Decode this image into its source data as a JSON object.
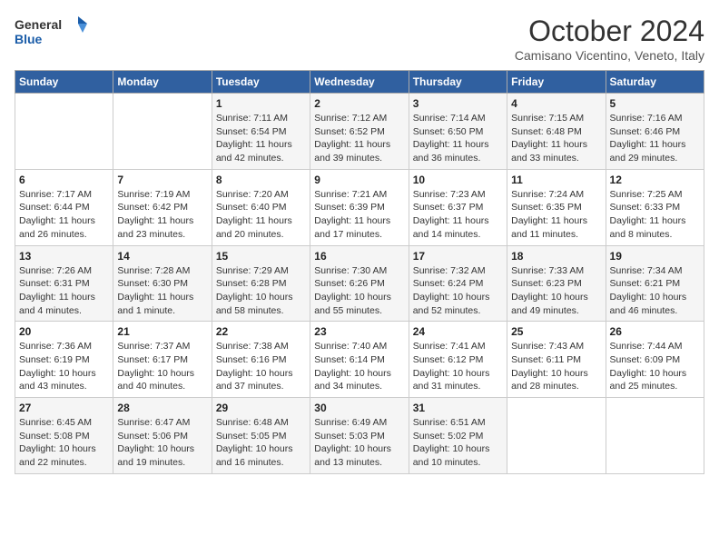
{
  "header": {
    "logo_general": "General",
    "logo_blue": "Blue",
    "month_title": "October 2024",
    "location": "Camisano Vicentino, Veneto, Italy"
  },
  "days_of_week": [
    "Sunday",
    "Monday",
    "Tuesday",
    "Wednesday",
    "Thursday",
    "Friday",
    "Saturday"
  ],
  "weeks": [
    [
      {
        "day": "",
        "sunrise": "",
        "sunset": "",
        "daylight": ""
      },
      {
        "day": "",
        "sunrise": "",
        "sunset": "",
        "daylight": ""
      },
      {
        "day": "1",
        "sunrise": "Sunrise: 7:11 AM",
        "sunset": "Sunset: 6:54 PM",
        "daylight": "Daylight: 11 hours and 42 minutes."
      },
      {
        "day": "2",
        "sunrise": "Sunrise: 7:12 AM",
        "sunset": "Sunset: 6:52 PM",
        "daylight": "Daylight: 11 hours and 39 minutes."
      },
      {
        "day": "3",
        "sunrise": "Sunrise: 7:14 AM",
        "sunset": "Sunset: 6:50 PM",
        "daylight": "Daylight: 11 hours and 36 minutes."
      },
      {
        "day": "4",
        "sunrise": "Sunrise: 7:15 AM",
        "sunset": "Sunset: 6:48 PM",
        "daylight": "Daylight: 11 hours and 33 minutes."
      },
      {
        "day": "5",
        "sunrise": "Sunrise: 7:16 AM",
        "sunset": "Sunset: 6:46 PM",
        "daylight": "Daylight: 11 hours and 29 minutes."
      }
    ],
    [
      {
        "day": "6",
        "sunrise": "Sunrise: 7:17 AM",
        "sunset": "Sunset: 6:44 PM",
        "daylight": "Daylight: 11 hours and 26 minutes."
      },
      {
        "day": "7",
        "sunrise": "Sunrise: 7:19 AM",
        "sunset": "Sunset: 6:42 PM",
        "daylight": "Daylight: 11 hours and 23 minutes."
      },
      {
        "day": "8",
        "sunrise": "Sunrise: 7:20 AM",
        "sunset": "Sunset: 6:40 PM",
        "daylight": "Daylight: 11 hours and 20 minutes."
      },
      {
        "day": "9",
        "sunrise": "Sunrise: 7:21 AM",
        "sunset": "Sunset: 6:39 PM",
        "daylight": "Daylight: 11 hours and 17 minutes."
      },
      {
        "day": "10",
        "sunrise": "Sunrise: 7:23 AM",
        "sunset": "Sunset: 6:37 PM",
        "daylight": "Daylight: 11 hours and 14 minutes."
      },
      {
        "day": "11",
        "sunrise": "Sunrise: 7:24 AM",
        "sunset": "Sunset: 6:35 PM",
        "daylight": "Daylight: 11 hours and 11 minutes."
      },
      {
        "day": "12",
        "sunrise": "Sunrise: 7:25 AM",
        "sunset": "Sunset: 6:33 PM",
        "daylight": "Daylight: 11 hours and 8 minutes."
      }
    ],
    [
      {
        "day": "13",
        "sunrise": "Sunrise: 7:26 AM",
        "sunset": "Sunset: 6:31 PM",
        "daylight": "Daylight: 11 hours and 4 minutes."
      },
      {
        "day": "14",
        "sunrise": "Sunrise: 7:28 AM",
        "sunset": "Sunset: 6:30 PM",
        "daylight": "Daylight: 11 hours and 1 minute."
      },
      {
        "day": "15",
        "sunrise": "Sunrise: 7:29 AM",
        "sunset": "Sunset: 6:28 PM",
        "daylight": "Daylight: 10 hours and 58 minutes."
      },
      {
        "day": "16",
        "sunrise": "Sunrise: 7:30 AM",
        "sunset": "Sunset: 6:26 PM",
        "daylight": "Daylight: 10 hours and 55 minutes."
      },
      {
        "day": "17",
        "sunrise": "Sunrise: 7:32 AM",
        "sunset": "Sunset: 6:24 PM",
        "daylight": "Daylight: 10 hours and 52 minutes."
      },
      {
        "day": "18",
        "sunrise": "Sunrise: 7:33 AM",
        "sunset": "Sunset: 6:23 PM",
        "daylight": "Daylight: 10 hours and 49 minutes."
      },
      {
        "day": "19",
        "sunrise": "Sunrise: 7:34 AM",
        "sunset": "Sunset: 6:21 PM",
        "daylight": "Daylight: 10 hours and 46 minutes."
      }
    ],
    [
      {
        "day": "20",
        "sunrise": "Sunrise: 7:36 AM",
        "sunset": "Sunset: 6:19 PM",
        "daylight": "Daylight: 10 hours and 43 minutes."
      },
      {
        "day": "21",
        "sunrise": "Sunrise: 7:37 AM",
        "sunset": "Sunset: 6:17 PM",
        "daylight": "Daylight: 10 hours and 40 minutes."
      },
      {
        "day": "22",
        "sunrise": "Sunrise: 7:38 AM",
        "sunset": "Sunset: 6:16 PM",
        "daylight": "Daylight: 10 hours and 37 minutes."
      },
      {
        "day": "23",
        "sunrise": "Sunrise: 7:40 AM",
        "sunset": "Sunset: 6:14 PM",
        "daylight": "Daylight: 10 hours and 34 minutes."
      },
      {
        "day": "24",
        "sunrise": "Sunrise: 7:41 AM",
        "sunset": "Sunset: 6:12 PM",
        "daylight": "Daylight: 10 hours and 31 minutes."
      },
      {
        "day": "25",
        "sunrise": "Sunrise: 7:43 AM",
        "sunset": "Sunset: 6:11 PM",
        "daylight": "Daylight: 10 hours and 28 minutes."
      },
      {
        "day": "26",
        "sunrise": "Sunrise: 7:44 AM",
        "sunset": "Sunset: 6:09 PM",
        "daylight": "Daylight: 10 hours and 25 minutes."
      }
    ],
    [
      {
        "day": "27",
        "sunrise": "Sunrise: 6:45 AM",
        "sunset": "Sunset: 5:08 PM",
        "daylight": "Daylight: 10 hours and 22 minutes."
      },
      {
        "day": "28",
        "sunrise": "Sunrise: 6:47 AM",
        "sunset": "Sunset: 5:06 PM",
        "daylight": "Daylight: 10 hours and 19 minutes."
      },
      {
        "day": "29",
        "sunrise": "Sunrise: 6:48 AM",
        "sunset": "Sunset: 5:05 PM",
        "daylight": "Daylight: 10 hours and 16 minutes."
      },
      {
        "day": "30",
        "sunrise": "Sunrise: 6:49 AM",
        "sunset": "Sunset: 5:03 PM",
        "daylight": "Daylight: 10 hours and 13 minutes."
      },
      {
        "day": "31",
        "sunrise": "Sunrise: 6:51 AM",
        "sunset": "Sunset: 5:02 PM",
        "daylight": "Daylight: 10 hours and 10 minutes."
      },
      {
        "day": "",
        "sunrise": "",
        "sunset": "",
        "daylight": ""
      },
      {
        "day": "",
        "sunrise": "",
        "sunset": "",
        "daylight": ""
      }
    ]
  ]
}
